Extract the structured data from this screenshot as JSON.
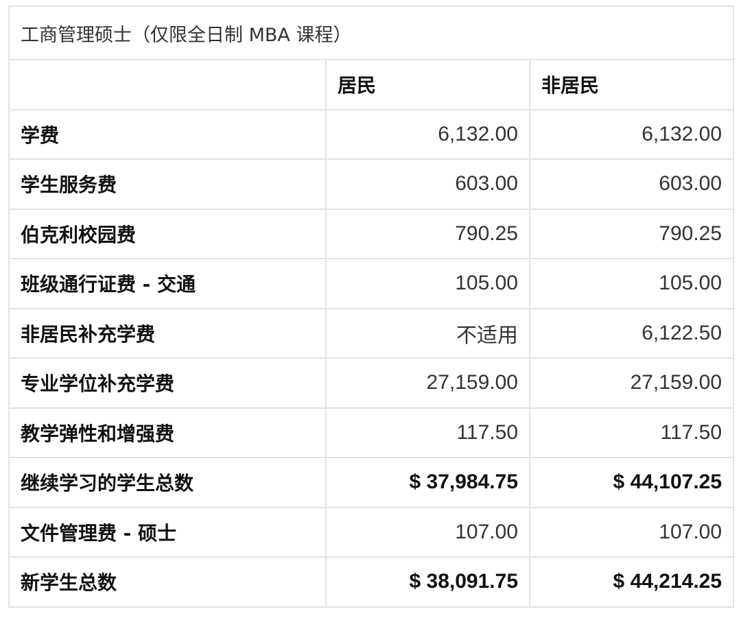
{
  "table": {
    "caption": "工商管理硕士（仅限全日制 MBA 课程）",
    "headers": [
      "",
      "居民",
      "非居民"
    ],
    "rows": [
      {
        "label": "学费",
        "resident": "6,132.00",
        "nonresident": "6,132.00",
        "bold": false
      },
      {
        "label": "学生服务费",
        "resident": "603.00",
        "nonresident": "603.00",
        "bold": false
      },
      {
        "label": "伯克利校园费",
        "resident": "790.25",
        "nonresident": "790.25",
        "bold": false
      },
      {
        "label": "班级通行证费 - 交通",
        "resident": "105.00",
        "nonresident": "105.00",
        "bold": false
      },
      {
        "label": "非居民补充学费",
        "resident": "不适用",
        "nonresident": "6,122.50",
        "bold": false
      },
      {
        "label": "专业学位补充学费",
        "resident": "27,159.00",
        "nonresident": "27,159.00",
        "bold": false
      },
      {
        "label": "教学弹性和增强费",
        "resident": "117.50",
        "nonresident": "117.50",
        "bold": false
      },
      {
        "label": "继续学习的学生总数",
        "resident": "$ 37,984.75",
        "nonresident": "$ 44,107.25",
        "bold": true
      },
      {
        "label": "文件管理费 - 硕士",
        "resident": "107.00",
        "nonresident": "107.00",
        "bold": false
      },
      {
        "label": "新学生总数",
        "resident": "$ 38,091.75",
        "nonresident": "$ 44,214.25",
        "bold": true
      }
    ]
  }
}
